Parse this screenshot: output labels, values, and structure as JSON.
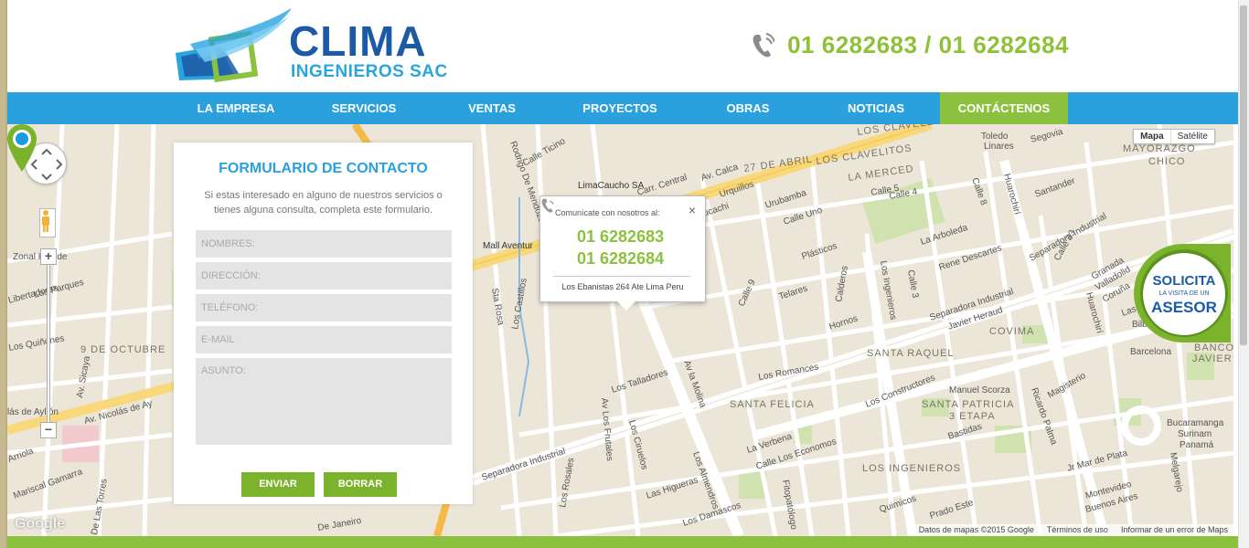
{
  "brand": {
    "name": "CLIMA",
    "subtitle": "INGENIEROS SAC"
  },
  "header": {
    "phone": "01 6282683 / 01 6282684"
  },
  "nav": {
    "items": [
      {
        "label": "LA EMPRESA"
      },
      {
        "label": "SERVICIOS"
      },
      {
        "label": "VENTAS"
      },
      {
        "label": "PROYECTOS"
      },
      {
        "label": "OBRAS"
      },
      {
        "label": "NOTICIAS"
      },
      {
        "label": "CONTÁCTENOS",
        "active": true
      }
    ]
  },
  "form": {
    "title": "FORMULARIO DE CONTACTO",
    "description": "Si estas interesado en alguno de nuestros servicios o tienes alguna consulta, completa este formulario.",
    "fields": {
      "name": "NOMBRES:",
      "address": "DIRECCIÓN:",
      "phone": "TELÉFONO:",
      "email": "E-MAIL",
      "subject": "ASUNTO:"
    },
    "send_label": "ENVIAR",
    "clear_label": "BORRAR"
  },
  "popup": {
    "heading": "Comunícate con nosotros al:",
    "close": "×",
    "phone1": "01 6282683",
    "phone2": "01 6282684",
    "address": "Los Ebanistas 264 Ate Lima Peru"
  },
  "badge": {
    "line1": "SOLICITA",
    "line2": "LA VISITA DE UN",
    "line3": "ASESOR"
  },
  "map": {
    "type_map": "Mapa",
    "type_satellite": "Satélite",
    "attribution": "Datos de mapas ©2015 Google",
    "terms": "Términos de uso",
    "report": "Informar de un error de Maps",
    "google": "Google",
    "labels": {
      "carr_central": "Carr. Central",
      "separadora_1": "Separadora Industrial",
      "separadora_2": "Separadora Industrial",
      "separadora_3": "Separadora Industrial",
      "los_ingenieros": "Los Ingenieros",
      "los_ingenieros_2": "LOS INGENIEROS",
      "los_constructores": "Los Constructores",
      "av_la_molina": "Av la Molina",
      "av_los_frutales": "Av Los Frutales",
      "nicolas_ayllon": "Av. Nicolás de Ay",
      "ayllon": "lás de Ayllón",
      "huarochiri_1": "Huarochirí",
      "huarochiri_2": "Huarochirí",
      "los_claveles": "LOS CLAVELES",
      "los_clavelitos": "LOS CLAVELITOS",
      "la_merced": "LA MERCED",
      "abril_27": "27 DE ABRIL",
      "santa_raquel": "SANTA RAQUEL",
      "santa_felicia": "SANTA FELICIA",
      "santa_patricia": "SANTA PATRICIA",
      "etapa3": "3 ETAPA",
      "covima": "COVIMA",
      "mayorazgo": "MAYORAZGO",
      "chico": "CHICO",
      "banco": "BANCO",
      "javier": "JAVIER",
      "octubre9": "9 DE OCTUBRE",
      "limacaucho": "LimaCaucho SA",
      "mall": "Mall Aventur",
      "los_talladores": "Los Talladores",
      "los_romances": "Los Romances",
      "calle_ticino": "Calle Ticino",
      "prado_este": "Prado Este",
      "rodrigo": "Rodrigo De Mendoza",
      "los_castillos": "Los Castillos",
      "los_ciruelos": "Los Ciruelos",
      "los_almendros": "Los Almendros",
      "las_higueras": "Las Higueras",
      "la_arboleda": "La Arboleda",
      "rene_descartes": "Rene Descartes",
      "javier_heraud": "Javier Heraud",
      "manuel_scorza": "Manuel Scorza",
      "bastidas": "Bastidas",
      "ricardo_palma": "Ricardo Palma",
      "magisterio": "Magisterio",
      "hornos": "Hornos",
      "telares": "Telares",
      "plasticos": "Plásticos",
      "urubamba": "Urubamba",
      "calle_uno": "Calle Uno",
      "huayucachi": "Huayucachi",
      "urquillos": "Urquillos",
      "av_calca": "Av. Calca",
      "calle5": "Calle 5",
      "calle4": "Calle 4",
      "calle3": "Calle 3",
      "calle8": "Calle 8",
      "calle9": "Calle 9",
      "calle33": "Calle 33",
      "calderos": "Calderos",
      "los_parques": "Los Parques",
      "libertadores": "Libertadores",
      "los_quinones": "Los Quiñones",
      "arriola": "Arriola",
      "mariscal_gamarra": "Mariscal Gamarra",
      "de_las_torres": "De Las Torres",
      "sta_rosa": "Sta Rosa",
      "av_sicaya": "Av. Sicaya",
      "zonal": "Zonal Huaide",
      "santander": "Santander",
      "segovia": "Segovia",
      "toledo": "Toledo",
      "linares": "Linares",
      "barcelona": "Barcelona",
      "bilbao": "Bilbao",
      "las_palmas": "Las Pal",
      "granada": "Granada",
      "valladolid": "Valladolid",
      "coruna": "Coruña",
      "bucaramanga": "Bucaramanga",
      "surinam": "Surinam",
      "panama": "Panamá",
      "jr_mar_de_plata": "Jr Mar de Plata",
      "montevideo": "Montevideo",
      "buenos_aires": "Buenos Aires",
      "melgarejo": "Melgarejo",
      "la_verbena": "La Verbena",
      "calle_economos": "Calle Los Economos",
      "quimicos": "Quimicos",
      "fitopatologo": "Fitopatólogo",
      "damascos": "Los Damascos",
      "los_rosales": "Los Rosales",
      "de_enero": "De Janeiro"
    }
  }
}
